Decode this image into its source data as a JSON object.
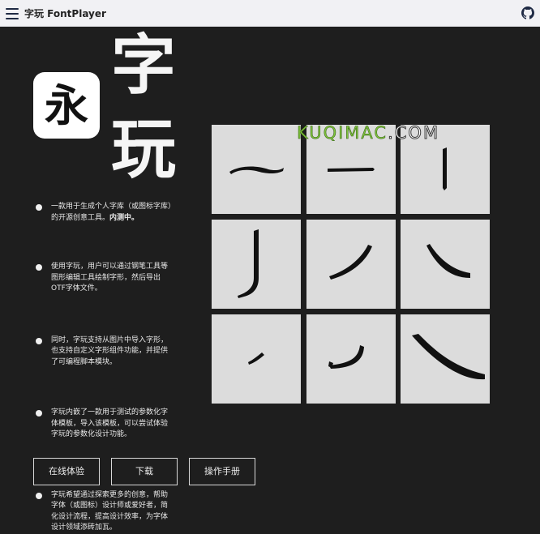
{
  "header": {
    "title": "字玩 FontPlayer",
    "menu_icon": "hamburger-menu-icon",
    "github_icon": "github-icon"
  },
  "hero": {
    "logo_char": "永",
    "title_chars": [
      "字",
      "玩"
    ]
  },
  "features": [
    {
      "text": "一款用于生成个人字库（或图标字库）的开源创意工具。",
      "bold": "内测中。"
    },
    {
      "text": "使用字玩，用户可以通过钢笔工具等图形编辑工具绘制字形，然后导出OTF字体文件。",
      "bold": ""
    },
    {
      "text": "同时，字玩支持从图片中导入字形，也支持自定义字形组件功能，并提供了可编程脚本模块。",
      "bold": ""
    },
    {
      "text": "字玩内嵌了一款用于测试的参数化字体模板，导入该模板，可以尝试体验字玩的参数化设计功能。",
      "bold": ""
    },
    {
      "text": "字玩希望通过探索更多的创意，帮助字体（或图标）设计师或爱好者，简化设计流程，提高设计效率，为字体设计领域添砖加瓦。",
      "bold": ""
    }
  ],
  "buttons": {
    "online": "在线体验",
    "download": "下载",
    "manual": "操作手册"
  },
  "watermark": {
    "part1": "KUQIMAC",
    "part2": ".COM"
  },
  "stroke_grid": [
    {
      "name": "horizontal-wave-stroke"
    },
    {
      "name": "horizontal-stroke"
    },
    {
      "name": "vertical-stroke"
    },
    {
      "name": "vertical-hook-stroke"
    },
    {
      "name": "left-falling-stroke"
    },
    {
      "name": "right-falling-stroke"
    },
    {
      "name": "dot-stroke"
    },
    {
      "name": "curved-stroke"
    },
    {
      "name": "long-right-falling-stroke"
    }
  ],
  "colors": {
    "background": "#1e1e1e",
    "topbar": "#f1f1f4",
    "tile": "#dcdcdc",
    "stroke": "#111111",
    "text": "#e8e8e8"
  }
}
